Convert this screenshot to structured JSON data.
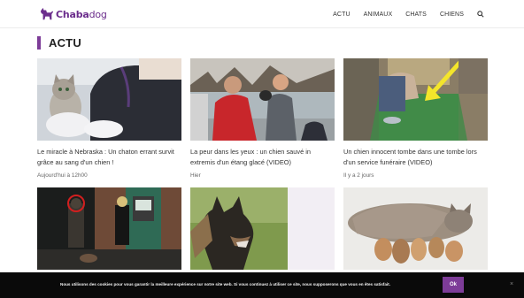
{
  "header": {
    "logo_part1": "Chaba",
    "logo_part2": "dog",
    "nav": [
      "ACTU",
      "ANIMAUX",
      "CHATS",
      "CHIENS"
    ]
  },
  "section": {
    "title": "ACTU"
  },
  "articles": [
    {
      "title": "Le miracle à Nebraska : Un chaton errant survit grâce au sang d'un chien !",
      "date": "Aujourd'hui à 12h00"
    },
    {
      "title": "La peur dans les yeux : un chien sauvé in extremis d'un étang glacé (VIDEO)",
      "date": "Hier"
    },
    {
      "title": "Un chien innocent tombe dans une tombe lors d'un service funéraire (VIDEO)",
      "date": "Il y a 2 jours"
    },
    {
      "title": "",
      "date": ""
    },
    {
      "title": "",
      "date": ""
    },
    {
      "title": "",
      "date": ""
    }
  ],
  "cookie": {
    "text": "Nous utilisons des cookies pour vous garantir la meilleure expérience sur notre site web. Si vous continuez à utiliser ce site, nous supposerons que vous en êtes satisfait.",
    "ok_label": "Ok",
    "close_label": "×"
  },
  "colors": {
    "accent": "#7d3c98",
    "logo": "#6b2d8c",
    "cookie_bg": "#0a0a0a"
  },
  "icons": [
    "dog-logo-icon",
    "search-icon",
    "close-icon"
  ]
}
